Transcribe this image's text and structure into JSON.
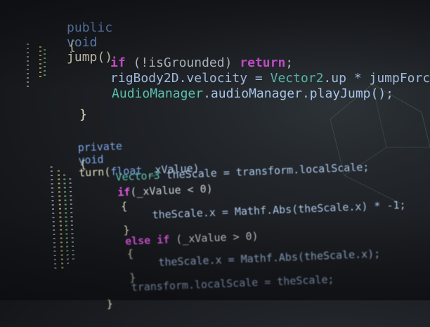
{
  "code": {
    "jump": {
      "kw_public": "public",
      "kw_void": "void",
      "fn_name": "jump",
      "parens": "()",
      "open_brace": "{",
      "close_brace": "}",
      "if_kw": "if",
      "if_cond": " (!isGrounded) ",
      "return_kw": "return",
      "semicolon": ";",
      "velocity_lhs": "rigBody2D.velocity = ",
      "velocity_type": "Vector2",
      "velocity_rhs": ".up * jumpForce;",
      "audio_type": "AudioManager",
      "audio_rest": ".audioManager.playJump();"
    },
    "turn": {
      "kw_private": "private",
      "kw_void": "void",
      "fn_name": "turn",
      "param_open": "(",
      "kw_float": "float",
      "param_rest": " _xValue)",
      "open_brace": "{",
      "scale_type": "Vector3",
      "scale_decl": " theScale = transform.localScale;",
      "if_kw": "if",
      "if_cond": "(_xValue < 0)",
      "inner_open_1": "{",
      "neg_line": "theScale.x = Mathf.Abs(theScale.x) * -1;",
      "inner_close_1": "}",
      "else_kw": "else",
      "else_if_kw": "if",
      "else_if_cond": " (_xValue > 0)",
      "inner_open_2": "{",
      "pos_line": "theScale.x = Mathf.Abs(theScale.x);",
      "inner_close_2": "}",
      "assign_line": "transform.localScale = theScale;",
      "close_brace": "}"
    }
  },
  "colors": {
    "keyword": "#79a6e8",
    "control": "#e058e6",
    "type": "#5bc2b0",
    "identifier": "#a9c5ea",
    "background": "#1a1d21"
  }
}
